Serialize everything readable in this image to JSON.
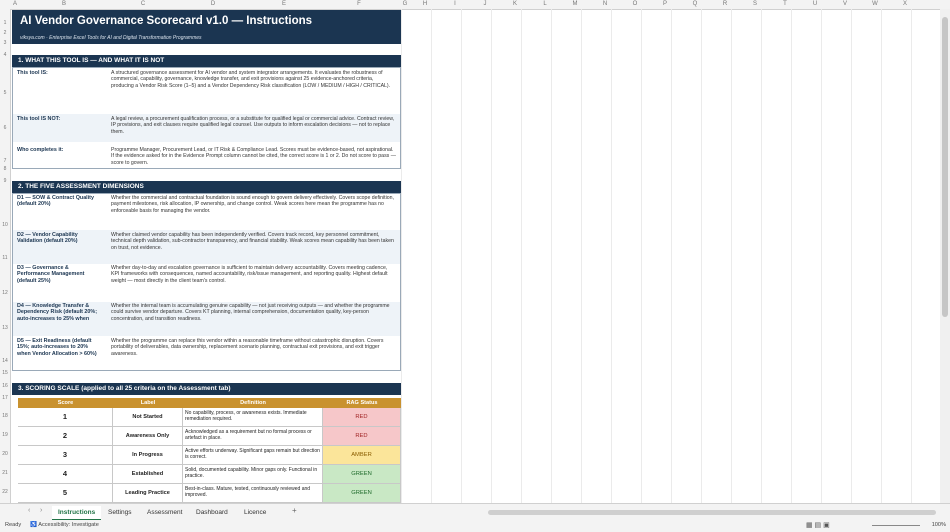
{
  "columns": [
    "A",
    "B",
    "C",
    "D",
    "E",
    "F",
    "G",
    "H",
    "I",
    "J",
    "K",
    "L",
    "M",
    "N",
    "O",
    "P",
    "Q",
    "R",
    "S",
    "T",
    "U",
    "V",
    "W",
    "X"
  ],
  "rows": [
    "1",
    "2",
    "3",
    "4",
    "5",
    "6",
    "7",
    "8",
    "9",
    "10",
    "11",
    "12",
    "13",
    "14",
    "15",
    "16",
    "17",
    "18",
    "19",
    "20",
    "21",
    "22"
  ],
  "title": "AI Vendor Governance Scorecard  v1.0 — Instructions",
  "subtitle": "viksya.com  ·  Enterprise Excel Tools for AI and Digital Transformation Programmes",
  "section1": {
    "heading": "1.  WHAT THIS TOOL IS — AND WHAT IT IS NOT",
    "rows": [
      {
        "label": "This tool IS:",
        "text": "A structured governance assessment for AI vendor and system integrator arrangements. It evaluates the robustness of commercial, capability, governance, knowledge transfer, and exit provisions against 25 evidence-anchored criteria, producing a Vendor Risk Score (1–5) and a Vendor Dependency Risk classification (LOW / MEDIUM / HIGH / CRITICAL)."
      },
      {
        "label": "This tool IS NOT:",
        "text": "A legal review, a procurement qualification process, or a substitute for qualified legal or commercial advice. Contract review, IP provisions, and exit clauses require qualified legal counsel. Use outputs to inform escalation decisions — not to replace them."
      },
      {
        "label": "Who completes it:",
        "text": "Programme Manager, Procurement Lead, or IT Risk & Compliance Lead. Scores must be evidence-based, not aspirational. If the evidence asked for in the Evidence Prompt column cannot be cited, the correct score is 1 or 2. Do not score to pass — score to govern."
      }
    ]
  },
  "section2": {
    "heading": "2.  THE FIVE ASSESSMENT DIMENSIONS",
    "rows": [
      {
        "label": "D1 — SOW & Contract Quality  (default 20%)",
        "text": "Whether the commercial and contractual foundation is sound enough to govern delivery effectively. Covers scope definition, payment milestones, risk allocation, IP ownership, and change control. Weak scores here mean the programme has no enforceable basis for managing the vendor."
      },
      {
        "label": "D2 — Vendor Capability Validation  (default 20%)",
        "text": "Whether claimed vendor capability has been independently verified. Covers track record, key personnel commitment, technical depth validation, sub-contractor transparency, and financial stability. Weak scores mean capability has been taken on trust, not evidence."
      },
      {
        "label": "D3 — Governance & Performance Management  (default 25%)",
        "text": "Whether day-to-day and escalation governance is sufficient to maintain delivery accountability. Covers meeting cadence, KPI frameworks with consequences, named accountability, risk/issue management, and reporting quality. Highest default weight — most directly in the client team's control."
      },
      {
        "label": "D4 — Knowledge Transfer & Dependency Risk  (default 20%; auto-increases to 25% when",
        "text": "Whether the internal team is accumulating genuine capability — not just receiving outputs — and whether the programme could survive vendor departure. Covers KT planning, internal comprehension, documentation quality, key-person concentration, and transition readiness."
      },
      {
        "label": "D5 — Exit Readiness  (default 15%; auto-increases to 20% when Vendor Allocation > 60%)",
        "text": "Whether the programme can replace this vendor within a reasonable timeframe without catastrophic disruption. Covers portability of deliverables, data ownership, replacement scenario planning, contractual exit provisions, and exit trigger awareness."
      }
    ]
  },
  "section3": {
    "heading": "3.  SCORING SCALE  (applied to all 25 criteria on the Assessment tab)",
    "headers": {
      "score": "Score",
      "label": "Label",
      "definition": "Definition",
      "rag": "RAG Status"
    },
    "rows": [
      {
        "score": "1",
        "label": "Not Started",
        "definition": "No capability, process, or awareness exists. Immediate remediation required.",
        "rag": "RED"
      },
      {
        "score": "2",
        "label": "Awareness Only",
        "definition": "Acknowledged as a requirement but no formal process or artefact in place.",
        "rag": "RED"
      },
      {
        "score": "3",
        "label": "In Progress",
        "definition": "Active efforts underway. Significant gaps remain but direction is correct.",
        "rag": "AMBER"
      },
      {
        "score": "4",
        "label": "Established",
        "definition": "Solid, documented capability. Minor gaps only. Functional in practice.",
        "rag": "GREEN"
      },
      {
        "score": "5",
        "label": "Leading Practice",
        "definition": "Best-in-class. Mature, tested, continuously reviewed and improved.",
        "rag": "GREEN"
      }
    ]
  },
  "tabs": [
    "Instructions",
    "Settings",
    "Assessment",
    "Dashboard",
    "Licence"
  ],
  "active_tab": "Instructions",
  "status": {
    "ready": "Ready",
    "accessibility": "Accessibility: Investigate",
    "zoom": "100%"
  }
}
